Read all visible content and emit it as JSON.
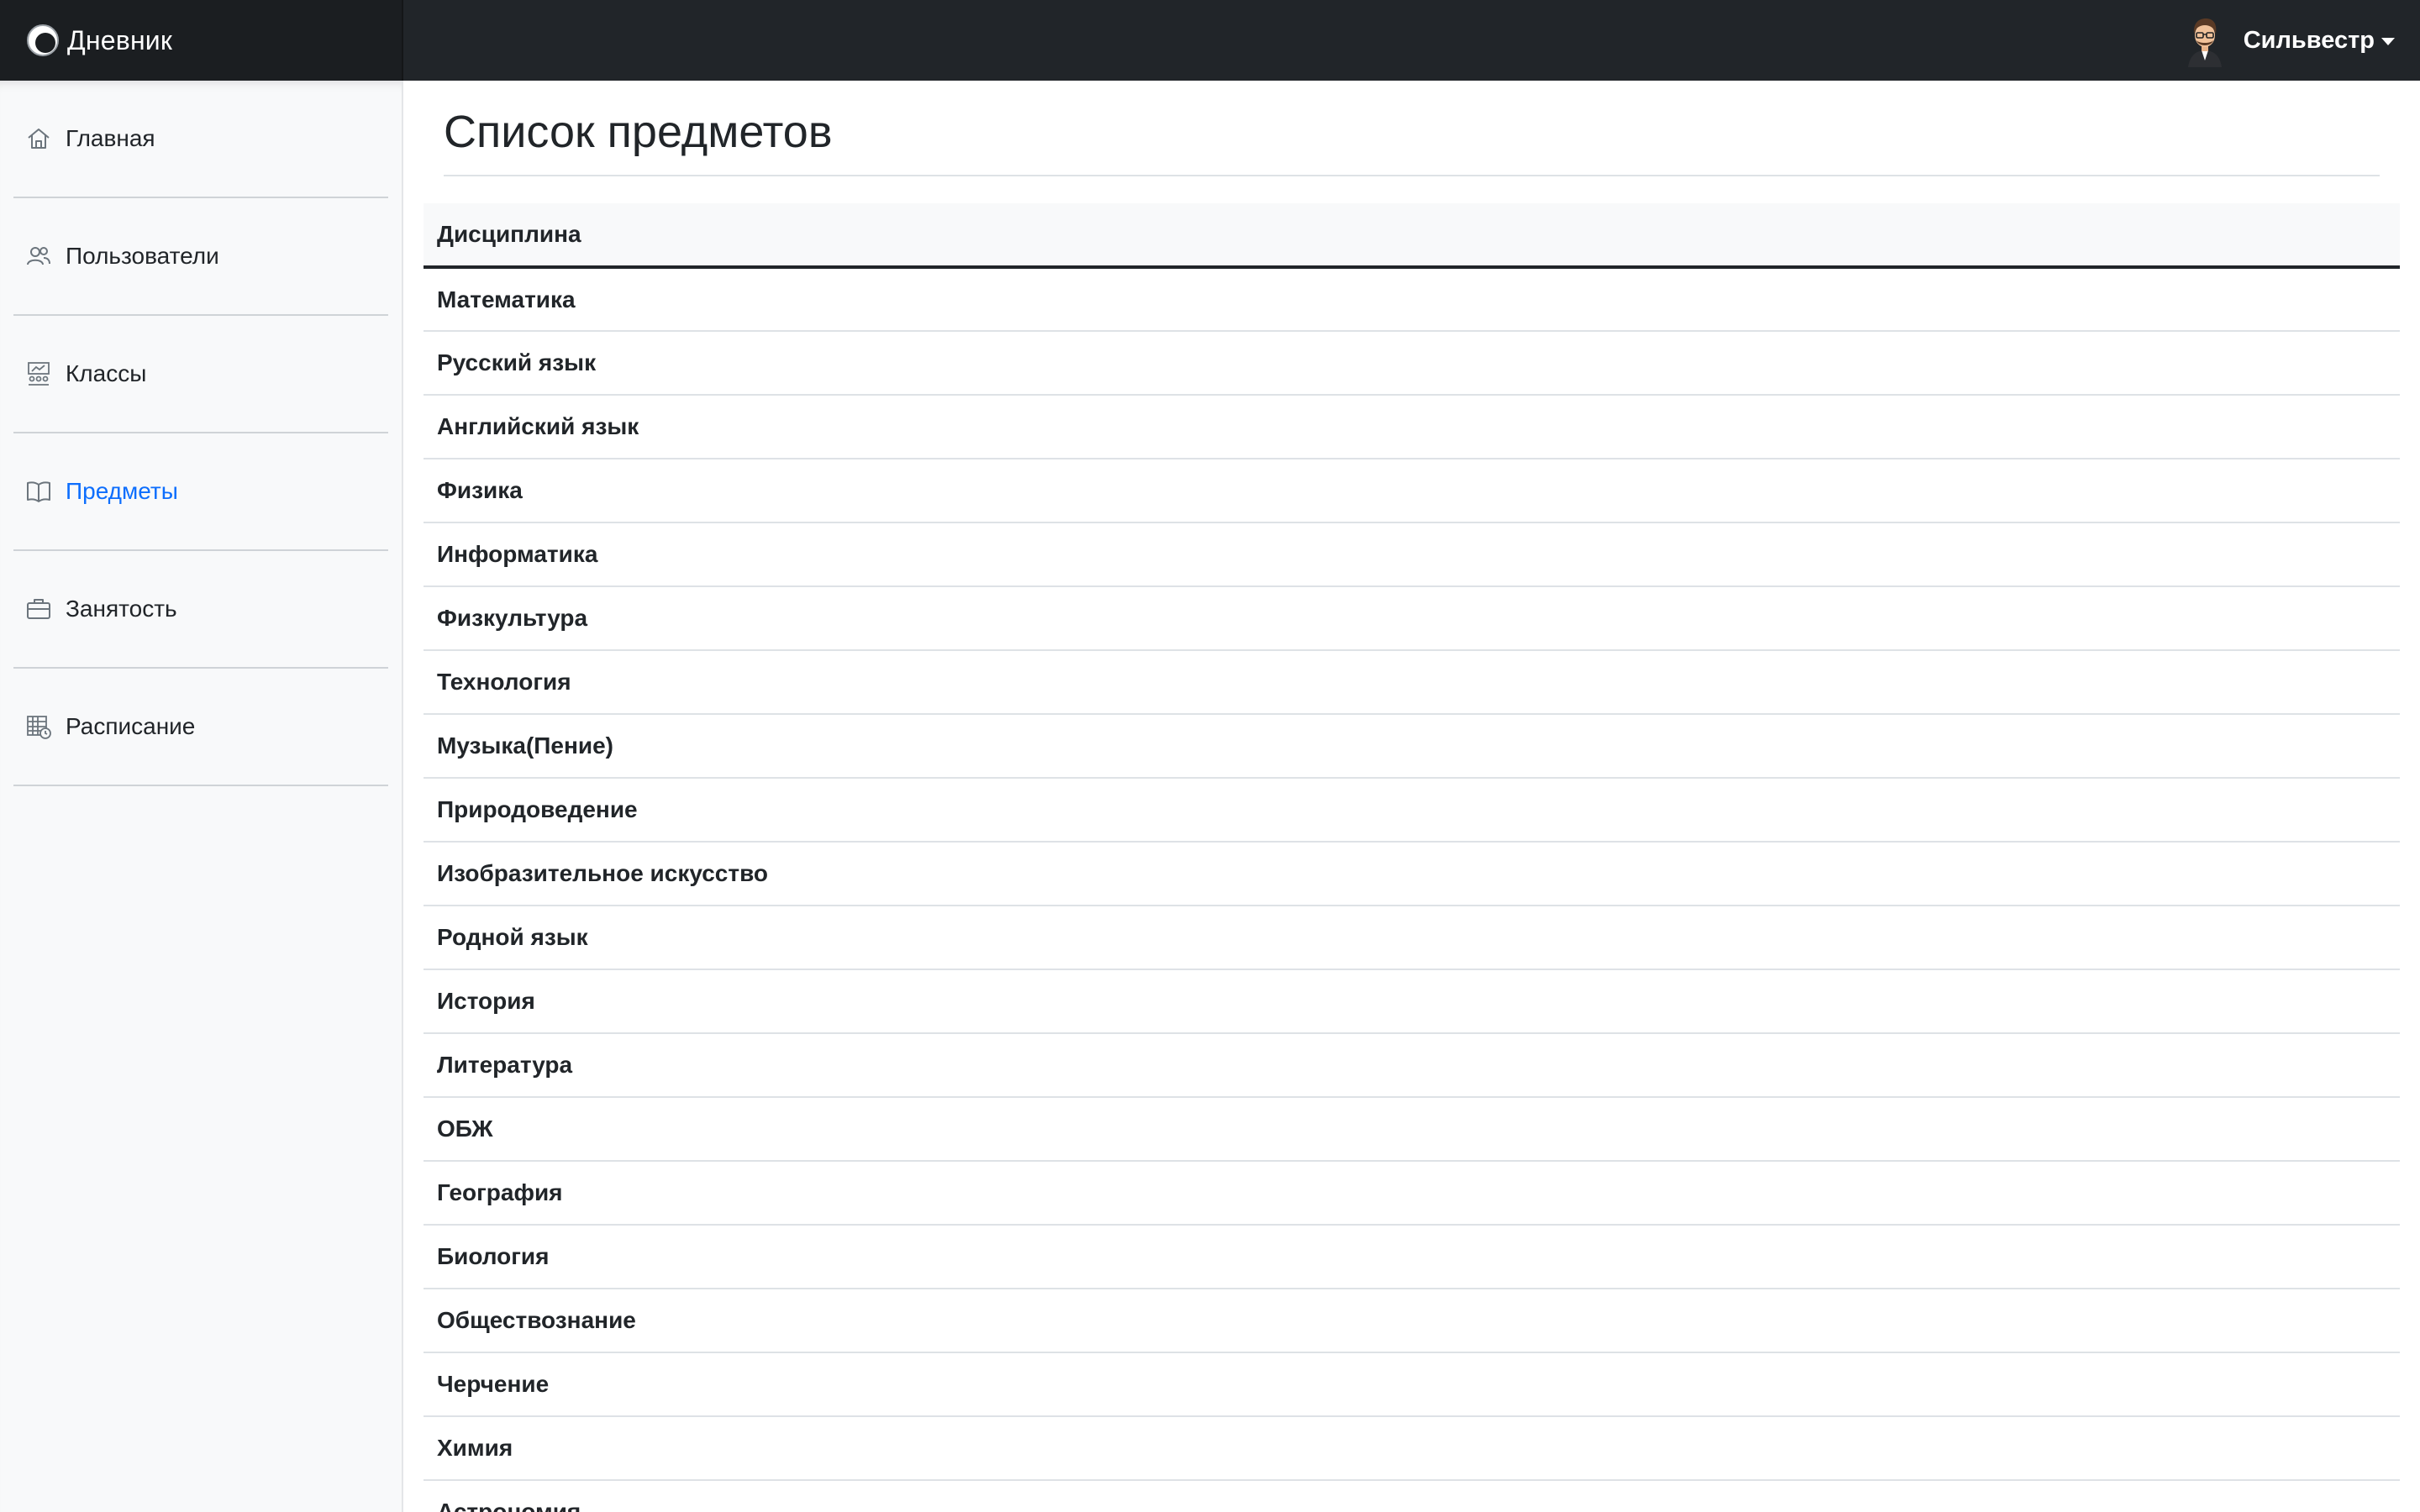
{
  "app": {
    "brand": "Дневник"
  },
  "user": {
    "name": "Сильвестр"
  },
  "sidebar": {
    "items": [
      {
        "label": "Главная",
        "icon": "home-icon",
        "active": false
      },
      {
        "label": "Пользователи",
        "icon": "users-icon",
        "active": false
      },
      {
        "label": "Классы",
        "icon": "classroom-icon",
        "active": false
      },
      {
        "label": "Предметы",
        "icon": "book-icon",
        "active": true
      },
      {
        "label": "Занятость",
        "icon": "briefcase-icon",
        "active": false
      },
      {
        "label": "Расписание",
        "icon": "calendar-clock-icon",
        "active": false
      }
    ]
  },
  "main": {
    "title": "Список предметов",
    "table": {
      "header": "Дисциплина",
      "rows": [
        "Математика",
        "Русский язык",
        "Английский язык",
        "Физика",
        "Информатика",
        "Физкультура",
        "Технология",
        "Музыка(Пение)",
        "Природоведение",
        "Изобразительное искусство",
        "Родной язык",
        "История",
        "Литература",
        "ОБЖ",
        "География",
        "Биология",
        "Обществознание",
        "Черчение",
        "Химия",
        "Астрономия"
      ]
    }
  },
  "colors": {
    "navbar": "#212529",
    "sidebar_bg": "#f8f9fa",
    "active_link": "#0d6efd",
    "text": "#212529"
  }
}
